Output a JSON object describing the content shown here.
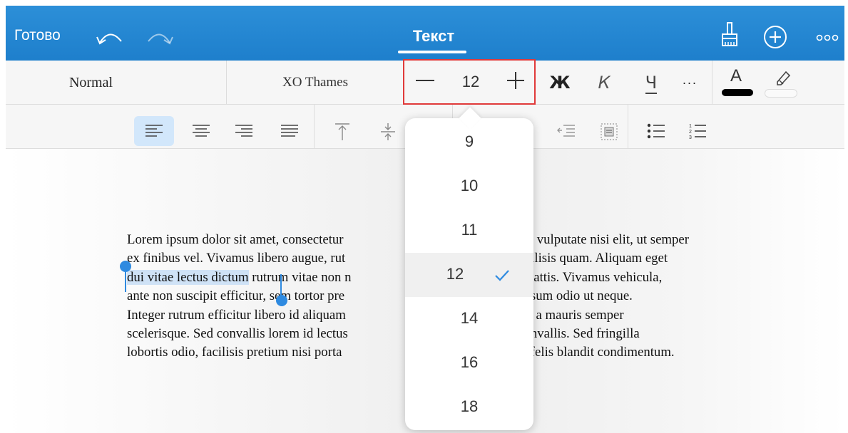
{
  "topbar": {
    "done_label": "Готово",
    "title": "Текст",
    "icons": [
      "undo-icon",
      "redo-icon",
      "brush-icon",
      "plus-circle-icon",
      "more-icon"
    ]
  },
  "format": {
    "style": "Normal",
    "font": "XO Thames",
    "size": "12",
    "bold": "Ж",
    "italic": "К",
    "underline": "Ч",
    "more": "···",
    "text_color_letter": "A",
    "text_color": "#000000"
  },
  "paragraph_tools": {
    "icons": [
      "align-left-icon",
      "align-center-icon",
      "align-right-icon",
      "align-justify-icon",
      "valign-top-icon",
      "valign-middle-icon",
      "valign-bottom-icon",
      "indent-decrease-icon",
      "text-frame-icon",
      "bullet-list-icon",
      "numbered-list-icon"
    ],
    "active": "align-left-icon"
  },
  "document": {
    "before_selection_line1": "Lorem ipsum dolor sit amet, consectetur ",
    "line1_right": "stibulum vulputate nisi elit, ut semper",
    "line2_left": "ex finibus vel. Vivamus libero augue, rut",
    "line2_right": "ringilla facilisis quam. Aliquam eget",
    "selected_text": "dui vitae lectus dictum",
    "line3_mid": " rutrum vitae non n",
    "line3_right": "facilisis mattis. Vivamus vehicula,",
    "line4_left": "ante non suscipit efficitur, sem tortor pre",
    "line4_right": "mentum ipsum odio ut neque.",
    "line5_left": "Integer rutrum efficitur libero id aliquam",
    "line5_right": "modo justo a mauris semper",
    "line6_left": "scelerisque. Sed convallis lorem id lectus",
    "line6_right": "m felis convallis. Sed fringilla",
    "line7_left": "lobortis odio, facilisis pretium nisi porta",
    "line7_right": "lio iaculis felis blandit condimentum."
  },
  "size_popover": {
    "options": [
      "9",
      "10",
      "11",
      "12",
      "14",
      "16",
      "18"
    ],
    "selected": "12",
    "accent": "#2e8ae0"
  },
  "colors": {
    "topbar": "#1e7fcc",
    "highlight_box": "#e03a3a",
    "selection": "#cfe2f6"
  }
}
